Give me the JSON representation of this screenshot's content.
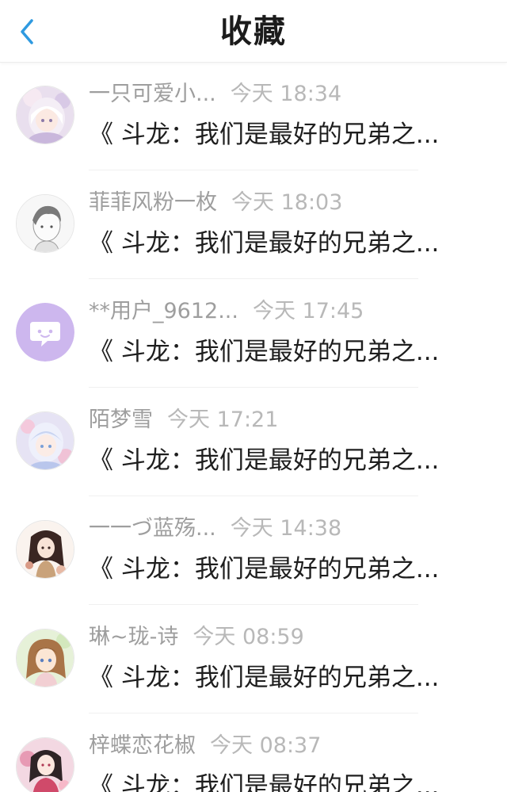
{
  "header": {
    "title": "收藏",
    "back_icon": "chevron-left-icon",
    "accent_color": "#2f9ae0"
  },
  "items": [
    {
      "name": "一只可爱小...",
      "time": "今天 18:34",
      "title": "《 斗龙：我们是最好的兄弟之...",
      "avatar": "anime-girl-white-hair"
    },
    {
      "name": "菲菲风粉一枚",
      "time": "今天 18:03",
      "title": "《 斗龙：我们是最好的兄弟之...",
      "avatar": "anime-boy-sketch"
    },
    {
      "name": "**用户_9612...",
      "time": "今天 17:45",
      "title": "《 斗龙：我们是最好的兄弟之...",
      "avatar": "default-chat-avatar"
    },
    {
      "name": "陌梦雪",
      "time": "今天 17:21",
      "title": "《 斗龙：我们是最好的兄弟之...",
      "avatar": "anime-girl-blue-pink"
    },
    {
      "name": "一一づ蓝殇...",
      "time": "今天 14:38",
      "title": "《 斗龙：我们是最好的兄弟之...",
      "avatar": "anime-girl-dark-hair"
    },
    {
      "name": "琳~珑-诗",
      "time": "今天 08:59",
      "title": "《 斗龙：我们是最好的兄弟之...",
      "avatar": "anime-girl-brown-hair"
    },
    {
      "name": "梓蝶恋花椒",
      "time": "今天 08:37",
      "title": "《 斗龙：我们是最好的兄弟之...",
      "avatar": "anime-girl-pink-red"
    }
  ]
}
